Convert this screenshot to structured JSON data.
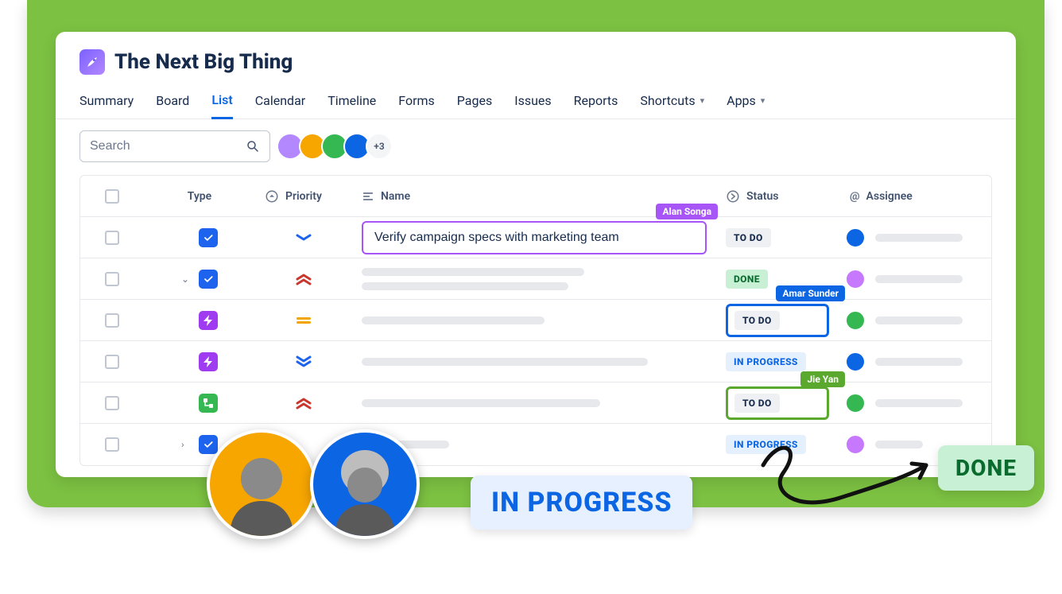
{
  "header": {
    "title": "The Next Big Thing"
  },
  "tabs": [
    {
      "label": "Summary",
      "active": false,
      "dropdown": false
    },
    {
      "label": "Board",
      "active": false,
      "dropdown": false
    },
    {
      "label": "List",
      "active": true,
      "dropdown": false
    },
    {
      "label": "Calendar",
      "active": false,
      "dropdown": false
    },
    {
      "label": "Timeline",
      "active": false,
      "dropdown": false
    },
    {
      "label": "Forms",
      "active": false,
      "dropdown": false
    },
    {
      "label": "Pages",
      "active": false,
      "dropdown": false
    },
    {
      "label": "Issues",
      "active": false,
      "dropdown": false
    },
    {
      "label": "Reports",
      "active": false,
      "dropdown": false
    },
    {
      "label": "Shortcuts",
      "active": false,
      "dropdown": true
    },
    {
      "label": "Apps",
      "active": false,
      "dropdown": true
    }
  ],
  "search": {
    "placeholder": "Search"
  },
  "avatar_colors": [
    "#b388ff",
    "#f7a600",
    "#35b851",
    "#0c66e4"
  ],
  "avatars_more": "+3",
  "columns": {
    "type": "Type",
    "priority": "Priority",
    "name": "Name",
    "status": "Status",
    "assignee": "Assignee"
  },
  "status_labels": {
    "todo": "TO DO",
    "done": "DONE",
    "in_progress": "IN PROGRESS"
  },
  "cursors": {
    "alan": "Alan Songa",
    "amar": "Amar Sunder",
    "jie": "Jie Yan"
  },
  "rows": [
    {
      "name": "Verify campaign specs with marketing team",
      "status": "todo",
      "assignee_color": "#0c66e4",
      "editing": true
    },
    {
      "status": "done",
      "assignee_color": "#c678ff"
    },
    {
      "status": "todo",
      "assignee_color": "#35b851",
      "select": "blue"
    },
    {
      "status": "in_progress",
      "assignee_color": "#0c66e4"
    },
    {
      "status": "todo",
      "assignee_color": "#35b851",
      "select": "green"
    },
    {
      "status": "in_progress",
      "assignee_color": "#c678ff"
    }
  ],
  "overlays": {
    "in_progress": "IN PROGRESS",
    "done": "DONE"
  }
}
